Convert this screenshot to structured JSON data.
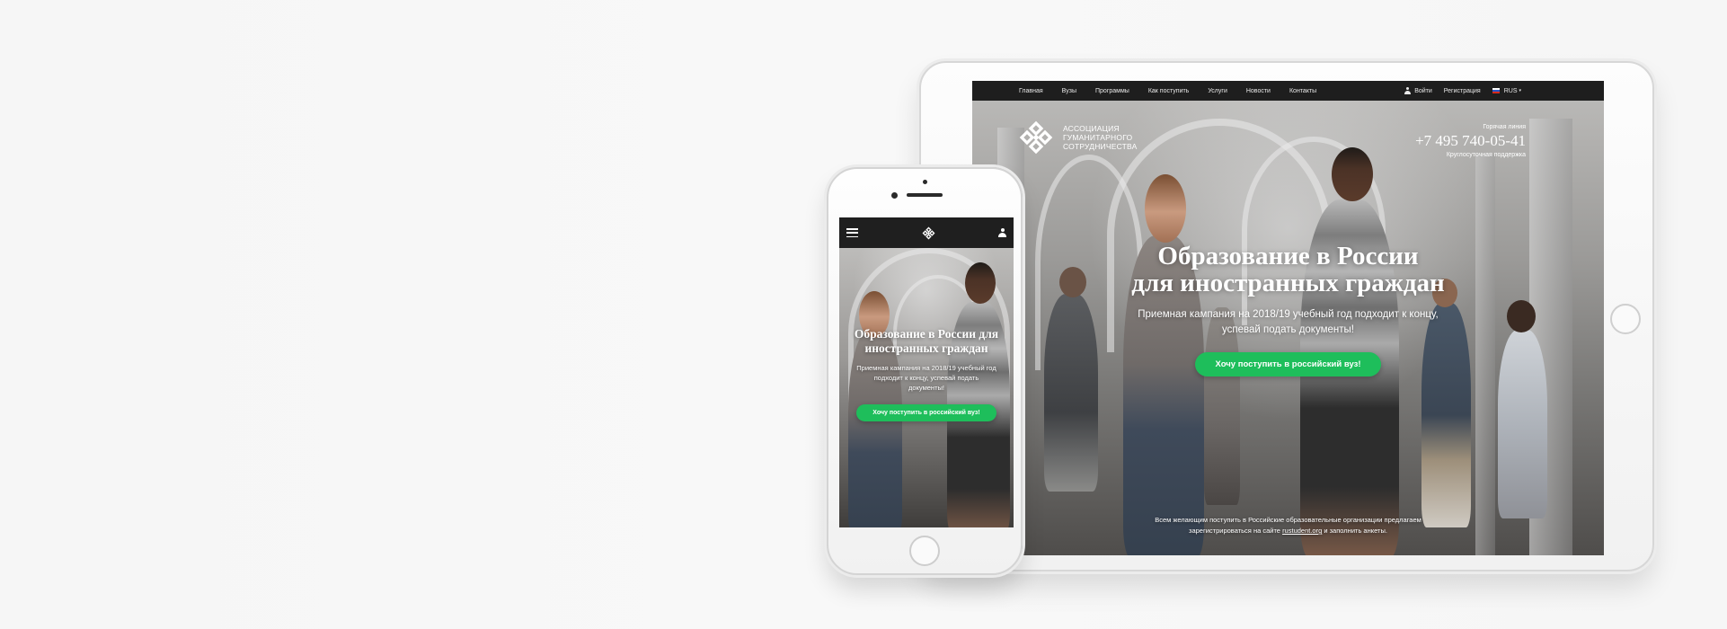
{
  "colors": {
    "accent": "#1ebe5b",
    "nav_bg": "#1e1e1e",
    "page_bg": "#f7f7f7"
  },
  "tablet": {
    "nav": {
      "items": [
        "Главная",
        "Вузы",
        "Программы",
        "Как поступить",
        "Услуги",
        "Новости",
        "Контакты"
      ],
      "login_label": "Войти",
      "register_label": "Регистрация",
      "lang_label": "RUS"
    },
    "logo": {
      "line1": "АССОЦИАЦИЯ",
      "line2": "ГУМАНИТАРНОГО",
      "line3": "СОТРУДНИЧЕСТВА"
    },
    "hotline": {
      "label": "Горячая линия",
      "phone": "+7 495 740-05-41",
      "sub": "Круглосуточная поддержка"
    },
    "hero": {
      "title_line1": "Образование в России",
      "title_line2": "для иностранных граждан",
      "sub_line1": "Приемная кампания на 2018/19 учебный год подходит к концу,",
      "sub_line2": "успевай подать документы!",
      "cta_label": "Хочу поступить в российский вуз!"
    },
    "footer": {
      "line1": "Всем желающим поступить в Российские образовательные организации предлагаем",
      "line2_before": "зарегистрироваться на сайте ",
      "link_text": "rustudent.org",
      "line2_after": " и заполнить анкеты."
    }
  },
  "phone": {
    "hero": {
      "title": "Образование в России для иностранных граждан",
      "sub": "Приемная кампания на 2018/19 учебный год подходит к концу, успевай подать документы!",
      "cta_label": "Хочу поступить в российский вуз!"
    },
    "icons": {
      "menu": "hamburger-menu-icon",
      "logo": "association-logo-icon",
      "user": "user-icon"
    }
  }
}
